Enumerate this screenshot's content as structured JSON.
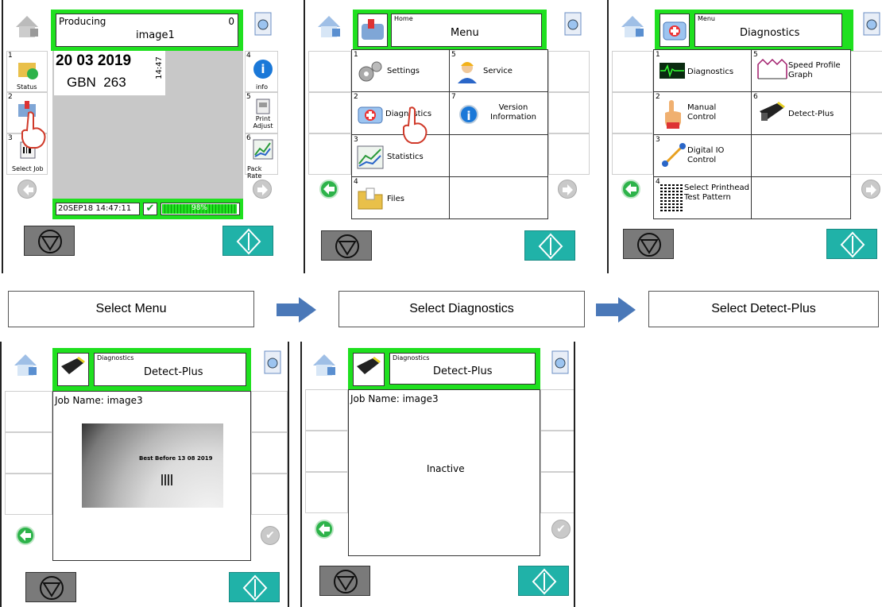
{
  "colors": {
    "header_green": "#1fe01f",
    "start_teal": "#20b2a8",
    "arrow_blue": "#4a78b8"
  },
  "steps": [
    {
      "label": "Select Menu"
    },
    {
      "label": "Select Diagnostics"
    },
    {
      "label": "Select Detect-Plus"
    }
  ],
  "screen1": {
    "header_title": "Producing",
    "header_count": "0",
    "header_job": "image1",
    "preview_date": "20 03 2019",
    "preview_code": "GBN  263",
    "preview_time": "14:47",
    "left": [
      {
        "num": "1",
        "label": "Status"
      },
      {
        "num": "2",
        "label": ""
      },
      {
        "num": "3",
        "label": "Select Job"
      }
    ],
    "right": [
      {
        "num": "4",
        "label": "info"
      },
      {
        "num": "5",
        "label": "Print Adjust"
      },
      {
        "num": "6",
        "label": "Pack Rate"
      }
    ],
    "status_time": "20SEP18 14:47:11",
    "progress_label": "98%",
    "progress": 0.98
  },
  "screen2": {
    "header_small": "Home",
    "header_big": "Menu",
    "items": [
      {
        "num": "1",
        "label": "Settings",
        "icon": "gears-icon"
      },
      {
        "num": "5",
        "label": "Service",
        "icon": "service-person-icon"
      },
      {
        "num": "2",
        "label": "Diagnostics",
        "icon": "first-aid-kit-icon"
      },
      {
        "num": "7",
        "label": "Version Information",
        "icon": "info-icon"
      },
      {
        "num": "3",
        "label": "Statistics",
        "icon": "statistics-chart-icon"
      },
      {
        "num": "4",
        "label": "Files",
        "icon": "folder-icon"
      }
    ]
  },
  "screen3": {
    "header_small": "Menu",
    "header_big": "Diagnostics",
    "items": [
      {
        "num": "1",
        "label": "Diagnostics",
        "icon": "waveform-icon"
      },
      {
        "num": "5",
        "label": "Speed Profile Graph",
        "icon": "speed-graph-icon"
      },
      {
        "num": "2",
        "label": "Manual Control",
        "icon": "hand-icon"
      },
      {
        "num": "6",
        "label": "Detect-Plus",
        "icon": "camera-icon"
      },
      {
        "num": "3",
        "label": "Digital IO Control",
        "icon": "digital-io-icon"
      },
      {
        "num": "4",
        "label": "Select Printhead Test Pattern",
        "icon": "test-pattern-icon"
      }
    ]
  },
  "screen4": {
    "header_small": "Diagnostics",
    "header_big": "Detect-Plus",
    "job_name": "Job Name: image3",
    "image_text": "Best Before 13 08 2019"
  },
  "screen5": {
    "header_small": "Diagnostics",
    "header_big": "Detect-Plus",
    "job_name": "Job Name: image3",
    "status": "Inactive"
  }
}
